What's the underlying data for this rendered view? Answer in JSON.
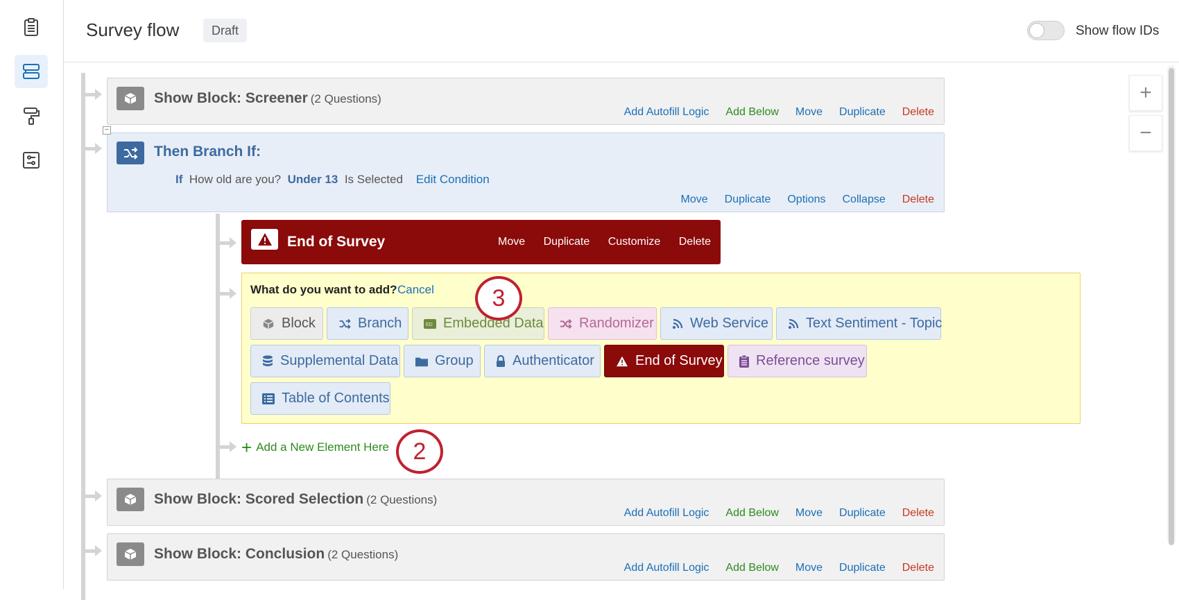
{
  "header": {
    "title": "Survey flow",
    "status": "Draft",
    "toggle_label": "Show flow IDs"
  },
  "rail": {
    "icons": [
      "survey-icon",
      "flow-icon",
      "look-and-feel-icon",
      "survey-options-icon"
    ],
    "active_index": 1
  },
  "blocks": [
    {
      "prefix": "Show Block: ",
      "name": "Screener",
      "count": "(2 Questions)"
    },
    {
      "prefix": "Show Block: ",
      "name": "Scored Selection",
      "count": "(2 Questions)"
    },
    {
      "prefix": "Show Block: ",
      "name": "Conclusion",
      "count": "(2 Questions)"
    }
  ],
  "block_actions": {
    "autofill": "Add Autofill Logic",
    "add_below": "Add Below",
    "move": "Move",
    "duplicate": "Duplicate",
    "delete": "Delete"
  },
  "branch": {
    "title": "Then Branch If:",
    "if_word": "If",
    "question": "How old are you?",
    "choice": "Under 13",
    "operator": "Is Selected",
    "edit": "Edit Condition",
    "actions": {
      "move": "Move",
      "duplicate": "Duplicate",
      "options": "Options",
      "collapse": "Collapse",
      "delete": "Delete"
    }
  },
  "end_of_survey": {
    "title": "End of Survey",
    "actions": {
      "move": "Move",
      "duplicate": "Duplicate",
      "customize": "Customize",
      "delete": "Delete"
    }
  },
  "add_panel": {
    "question": "What do you want to add?",
    "cancel": "Cancel",
    "options": {
      "block": "Block",
      "branch": "Branch",
      "embedded_data": "Embedded Data",
      "randomizer": "Randomizer",
      "web_service": "Web Service",
      "text_sentiment": "Text Sentiment - Topic",
      "supplemental_data": "Supplemental Data",
      "group": "Group",
      "authenticator": "Authenticator",
      "end_of_survey": "End of Survey",
      "reference_survey": "Reference survey",
      "table_of_contents": "Table of Contents"
    }
  },
  "add_new": "Add a New Element Here",
  "callouts": {
    "first": "3",
    "second": "2"
  },
  "zoom": {
    "in": "+",
    "out": "−"
  },
  "colors": {
    "accent_blue": "#1a6fb7",
    "add_green": "#2c8a1d",
    "delete_red": "#c8361f",
    "end_of_survey": "#8b0a0a",
    "callout": "#c0212f",
    "add_panel_bg": "#ffffcc"
  }
}
